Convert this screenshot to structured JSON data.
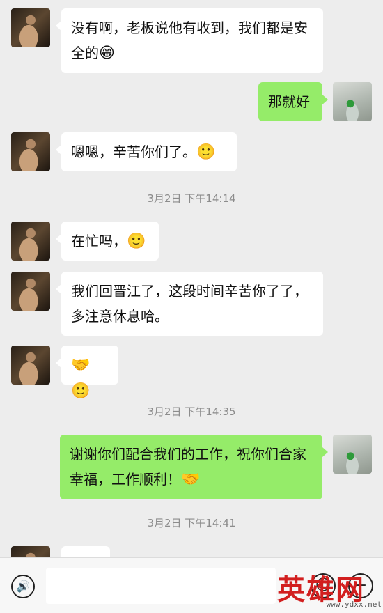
{
  "messages": [
    {
      "side": "left",
      "text": "没有啊，老板说他有收到，我们都是安全的",
      "emoji": "😁"
    },
    {
      "side": "right",
      "text": "那就好"
    },
    {
      "side": "left",
      "text": "嗯嗯，辛苦你们了。",
      "emoji": "🙂"
    },
    {
      "timestamp": "3月2日 下午14:14"
    },
    {
      "side": "left",
      "text": "在忙吗，",
      "emoji": "🙂"
    },
    {
      "side": "left",
      "text": "我们回晋江了，这段时间辛苦你了了，多注意休息哈。"
    },
    {
      "side": "left",
      "text": "",
      "emoji": "🤝🙂"
    },
    {
      "timestamp": "3月2日 下午14:35"
    },
    {
      "side": "right",
      "text": "谢谢你们配合我们的工作，祝你们合家幸福，工作顺利！",
      "emoji": "🤝"
    },
    {
      "timestamp": "3月2日 下午14:41"
    }
  ],
  "bottom_bar": {
    "voice_icon": "voice-icon",
    "emoji_icon": "smile-icon",
    "plus_icon": "plus-icon",
    "voice_glyph": "🔊",
    "emoji_glyph": "☺",
    "plus_glyph": "+"
  },
  "watermark": {
    "text": "英雄网",
    "url": "www.ydxx.net"
  }
}
